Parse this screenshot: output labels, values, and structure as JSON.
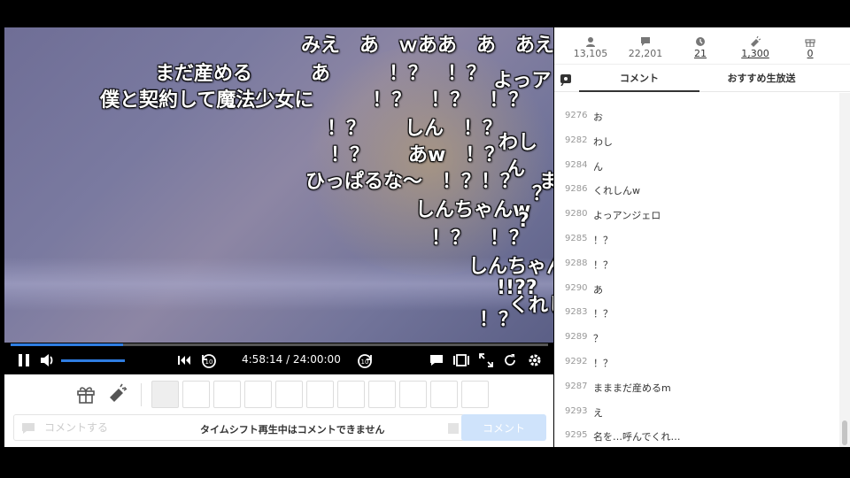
{
  "danmaku": [
    {
      "text": "みえ　あ　ｗああ　あ　あえ"
    },
    {
      "text": "まだ産める　　　あ　　　！？　！？"
    },
    {
      "text": "よっア"
    },
    {
      "text": "僕と契約して魔法少女に　　　！？　！？　！？"
    },
    {
      "text": "！？　　しん　！？"
    },
    {
      "text": "わし"
    },
    {
      "text": "！？　　あw　！？"
    },
    {
      "text": "ん"
    },
    {
      "text": "ひっぱるな～　！？！？　まま"
    },
    {
      "text": "しんちゃんw"
    },
    {
      "text": "！？　！？"
    },
    {
      "text": "しんちゃん"
    },
    {
      "text": "!!??"
    },
    {
      "text": "くれし"
    },
    {
      "text": "！？"
    },
    {
      "text": "?"
    },
    {
      "text": "？"
    }
  ],
  "player": {
    "progress": 0.21,
    "volume": 1.0,
    "time": "4:58:14 / 24:00:00",
    "seek_back_label": "10",
    "seek_fwd_label": "10",
    "icons": [
      "pause-icon",
      "volume-icon",
      "skip-start-icon",
      "rewind-10-icon",
      "forward-10-icon",
      "comment-toggle-icon",
      "theater-mode-icon",
      "fullscreen-icon",
      "reload-icon",
      "settings-icon"
    ]
  },
  "below": {
    "comment_placeholder": "コメントする",
    "notice": "タイムシフト再生中はコメントできません",
    "comment_button": "コメント",
    "gift_icon": "gift-icon",
    "nicoad_icon": "nicoad-icon"
  },
  "stats": [
    {
      "icon": "viewer-icon",
      "value": "13,105",
      "link": false
    },
    {
      "icon": "comment-count-icon",
      "value": "22,201",
      "link": false
    },
    {
      "icon": "timeshift-icon",
      "value": "21",
      "link": true
    },
    {
      "icon": "nicoad-icon",
      "value": "1,300",
      "link": true
    },
    {
      "icon": "gift-icon",
      "value": "0",
      "link": true
    }
  ],
  "tabs": {
    "comment": "コメント",
    "recommended": "おすすめ生放送"
  },
  "comments": [
    {
      "no": "9276",
      "text": "お"
    },
    {
      "no": "9282",
      "text": "わし"
    },
    {
      "no": "9284",
      "text": "ん"
    },
    {
      "no": "9286",
      "text": "くれしんw"
    },
    {
      "no": "9280",
      "text": "よっアンジェロ"
    },
    {
      "no": "9285",
      "text": "！？"
    },
    {
      "no": "9288",
      "text": "！？"
    },
    {
      "no": "9290",
      "text": "あ"
    },
    {
      "no": "9283",
      "text": "！？"
    },
    {
      "no": "9289",
      "text": "？"
    },
    {
      "no": "9292",
      "text": "！？"
    },
    {
      "no": "9287",
      "text": "まままだ産めるm"
    },
    {
      "no": "9293",
      "text": "え"
    },
    {
      "no": "9295",
      "text": "名を…呼んでくれ…"
    }
  ]
}
